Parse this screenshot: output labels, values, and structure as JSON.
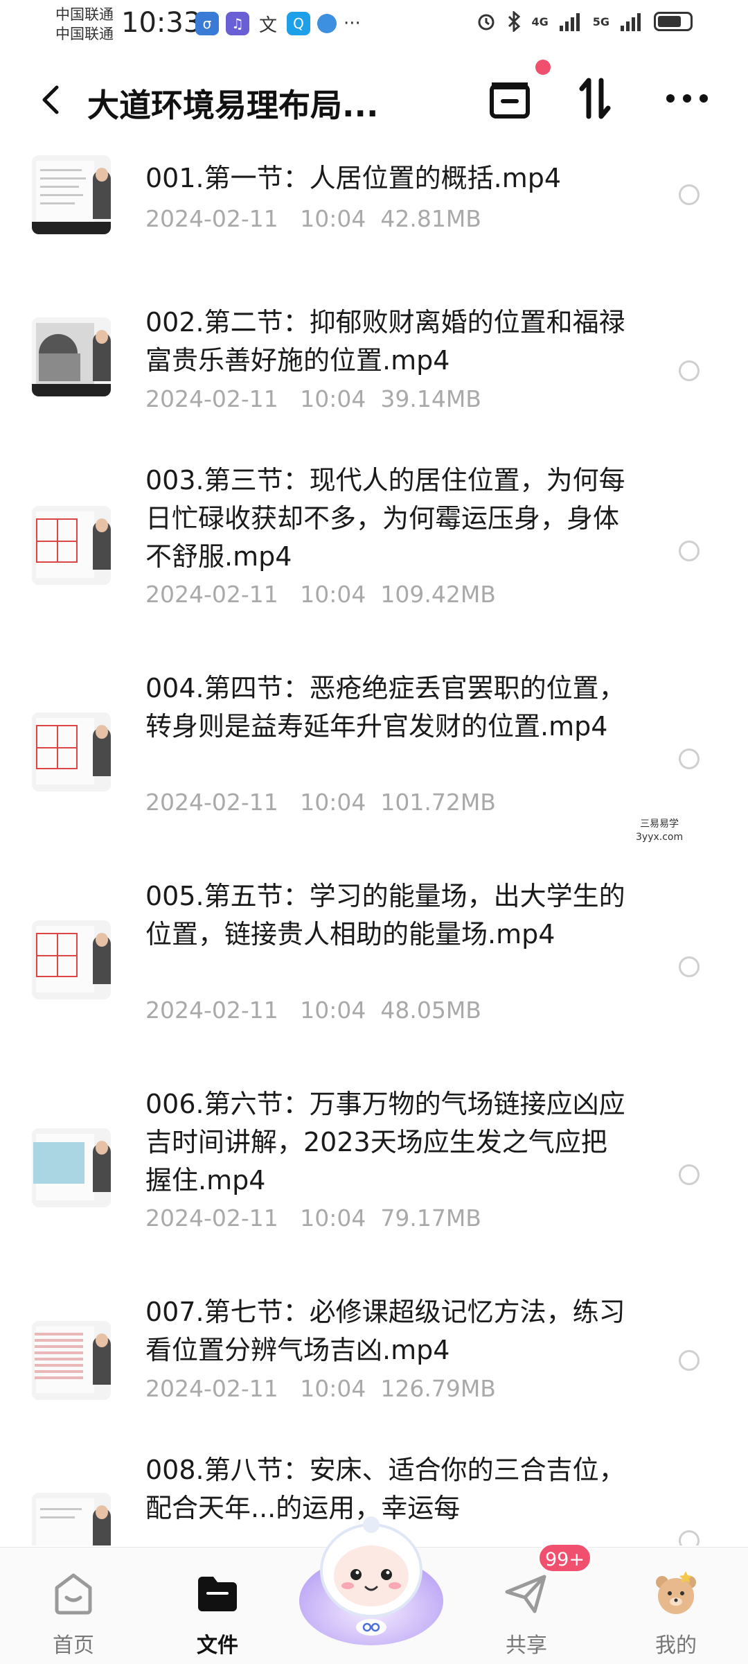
{
  "status_bar": {
    "carrier1": "中国联通",
    "carrier2": "中国联通",
    "time": "10:33",
    "net1": "4G",
    "net2": "5G",
    "battery_level": 0.75,
    "more": "···"
  },
  "header": {
    "back_icon": "chevron-left-icon",
    "title": "大道环境易理布局..."
  },
  "files": [
    {
      "name": "001.第一节：人居位置的概括.mp4",
      "date": "2024-02-11",
      "time": "10:04",
      "size": "42.81MB",
      "thumb": "page"
    },
    {
      "name": "002.第二节：抑郁败财离婚的位置和福禄富贵乐善好施的位置.mp4",
      "date": "2024-02-11",
      "time": "10:04",
      "size": "39.14MB",
      "thumb": "photo"
    },
    {
      "name": "003.第三节：现代人的居住位置，为何每日忙碌收获却不多，为何霉运压身，身体不舒服.mp4",
      "date": "2024-02-11",
      "time": "10:04",
      "size": "109.42MB",
      "thumb": "grid"
    },
    {
      "name": "004.第四节：恶疮绝症丢官罢职的位置，转身则是益寿延年升官发财的位置.mp4",
      "date": "2024-02-11",
      "time": "10:04",
      "size": "101.72MB",
      "thumb": "grid"
    },
    {
      "name": "005.第五节：学习的能量场，出大学生的位置，链接贵人相助的能量场.mp4",
      "date": "2024-02-11",
      "time": "10:04",
      "size": "48.05MB",
      "thumb": "grid"
    },
    {
      "name": "006.第六节：万事万物的气场链接应凶应吉时间讲解，2023天场应生发之气应把握住.mp4",
      "date": "2024-02-11",
      "time": "10:04",
      "size": "79.17MB",
      "thumb": "blue"
    },
    {
      "name": "007.第七节：必修课超级记忆方法，练习看位置分辨气场吉凶.mp4",
      "date": "2024-02-11",
      "time": "10:04",
      "size": "126.79MB",
      "thumb": "red"
    },
    {
      "name": "008.第八节：安床、适合你的三合吉位，配合天年...的运用，幸运每",
      "date": "",
      "time": "",
      "size": "",
      "thumb": "page"
    }
  ],
  "watermark": {
    "line1": "三易易学",
    "line2": "3yyx.com"
  },
  "nav": {
    "home": "首页",
    "files": "文件",
    "share": "共享",
    "mine": "我的",
    "share_badge": "99+"
  },
  "colors": {
    "accent": "#f0506e",
    "meta": "#a9a9a9"
  }
}
